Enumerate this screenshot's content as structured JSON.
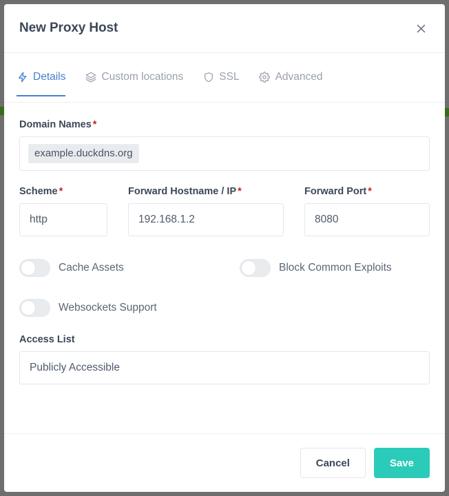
{
  "window": {
    "title": "New Proxy Host",
    "close_icon": "close-icon"
  },
  "tabs": [
    {
      "label": "Details",
      "icon": "zap-icon",
      "active": true
    },
    {
      "label": "Custom locations",
      "icon": "layers-icon",
      "active": false
    },
    {
      "label": "SSL",
      "icon": "shield-icon",
      "active": false
    },
    {
      "label": "Advanced",
      "icon": "gear-icon",
      "active": false
    }
  ],
  "form": {
    "domain_names": {
      "label": "Domain Names",
      "required_marker": "*",
      "tags": [
        "example.duckdns.org"
      ]
    },
    "scheme": {
      "label": "Scheme",
      "required_marker": "*",
      "value": "http"
    },
    "forward_hostname": {
      "label": "Forward Hostname / IP",
      "required_marker": "*",
      "value": "192.168.1.2"
    },
    "forward_port": {
      "label": "Forward Port",
      "required_marker": "*",
      "value": "8080"
    },
    "toggles": [
      {
        "label": "Cache Assets",
        "on": false
      },
      {
        "label": "Block Common Exploits",
        "on": false
      },
      {
        "label": "Websockets Support",
        "on": false
      }
    ],
    "access_list": {
      "label": "Access List",
      "value": "Publicly Accessible"
    }
  },
  "footer": {
    "cancel_label": "Cancel",
    "save_label": "Save"
  },
  "colors": {
    "accent_blue": "#467fcf",
    "save_teal": "#2bcbba",
    "required_red": "#cd201f",
    "text_dark": "#3c4858",
    "text_muted": "#9aa0ac",
    "border": "#e3e6ea",
    "tag_bg": "#e9ecef",
    "backdrop": "#6e6e6e"
  }
}
